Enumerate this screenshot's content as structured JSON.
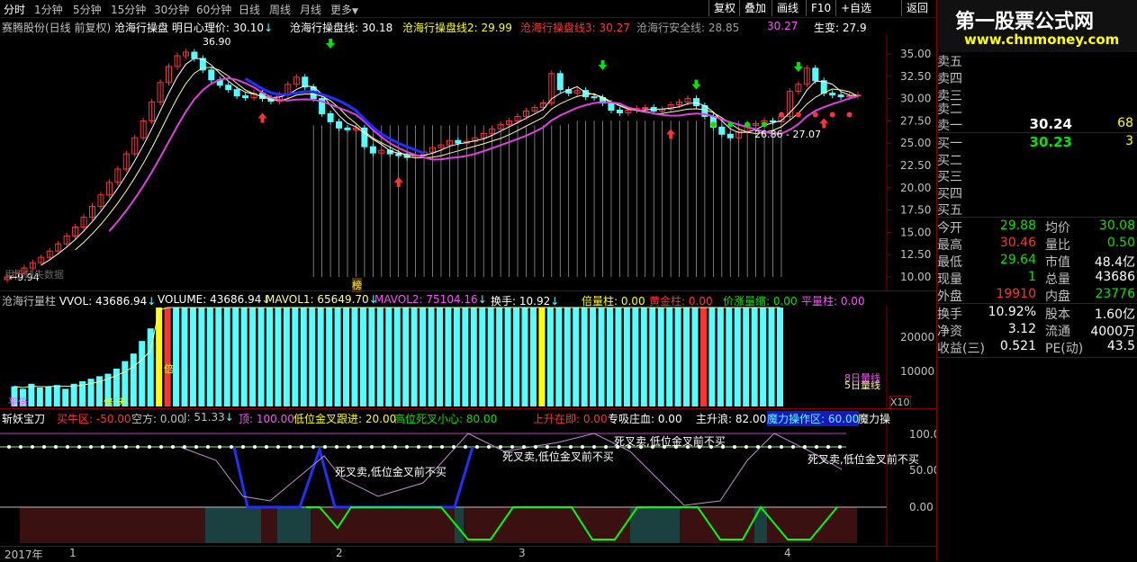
{
  "toolbar": {
    "tabs": [
      "分时",
      "1分钟",
      "5分钟",
      "15分钟",
      "30分钟",
      "60分钟",
      "日线",
      "周线",
      "月线",
      "更多"
    ],
    "active_tab": "分时",
    "more_arrow": "▼",
    "buttons": [
      "复权",
      "叠加",
      "画线",
      "F10",
      "+自选",
      "返回"
    ]
  },
  "main_legend": {
    "stock": "赛腾股份(日线 前复权)",
    "indicator": "沧海行操盘",
    "pivot": "明日心理价: 30.10",
    "line1": "沧海行操盘线: 30.18",
    "line2": "沧海行操盘线2: 29.99",
    "line3": "沧海行操盘线3: 30.27",
    "safe": "沧海行安全线: 28.85",
    "extra": "30.27",
    "change": "生变: 27.9"
  },
  "main_annotations": {
    "high_label": "36.90",
    "low_label": "9.94",
    "range_label": "26.86 - 27.07",
    "data_hint": "用于缺失数据",
    "buy_flag": "榜",
    "gap_tag": "缺"
  },
  "price_axis": [
    "35.00",
    "32.50",
    "30.00",
    "27.50",
    "25.00",
    "22.50",
    "20.00",
    "17.50",
    "15.00",
    "12.50",
    "10.00"
  ],
  "volume_legend": {
    "name": "沧海行量柱",
    "vvol": "VVOL: 43686.94",
    "volume": "VOLUME: 43686.94",
    "mavol1": "MAVOL1: 65649.70",
    "mavol2": "MAVOL2: 75104.16",
    "turnover": "换手: 10.92",
    "double": "倍量柱: 0.00",
    "gold": "黄金柱: 0.00",
    "shrink": "价涨量缩: 0.00",
    "flat": "平量柱: 0.00"
  },
  "volume_axis": [
    "20000",
    "10000"
  ],
  "volume_unit": "X10",
  "volume_tags": {
    "double": "倍",
    "flat": "平倍",
    "tian": "倍 天",
    "five": "5日量线",
    "eight": "8日量线"
  },
  "osc_legend": {
    "name": "斩妖宝刀",
    "buy_zone": "买牛区: -50.00",
    "short_zone": "空方: 0.00",
    "j": "J: 51.33",
    "top": "顶: 100.00",
    "low_gold": "低位金叉跟进: 20.00",
    "high_dead": "高位死叉小心: 80.00",
    "rise": "上升在即: 0.00",
    "absorb": "专吸庄血: 0.00",
    "wave": "主升浪: 82.00",
    "magic_zone": "魔力操作区: 60.00",
    "magic": "魔力操"
  },
  "osc_axis": [
    "100.0",
    "50.00",
    "0.00"
  ],
  "osc_notes": [
    "死叉卖,低位金叉前不买",
    "死叉卖,低位金叉前不买",
    "死叉卖,低位金叉前不买",
    "死叉卖,低位金叉前不买"
  ],
  "date_axis": [
    "2017年",
    "1",
    "2",
    "3",
    "4"
  ],
  "quote": {
    "sell_labels": [
      "卖五",
      "卖四",
      "卖三",
      "卖二",
      "卖一"
    ],
    "sell1_price": "30.24",
    "sell1_vol": "68",
    "buy_labels": [
      "买一",
      "买二",
      "买三",
      "买四",
      "买五"
    ],
    "buy1_price": "30.23",
    "buy1_vol": "3"
  },
  "stats": [
    {
      "l1": "今开",
      "v1": "29.88",
      "c1": "green",
      "l2": "均价",
      "v2": "30.08",
      "c2": "green"
    },
    {
      "l1": "最高",
      "v1": "30.46",
      "c1": "red",
      "l2": "量比",
      "v2": "0.50",
      "c2": "green"
    },
    {
      "l1": "最低",
      "v1": "29.64",
      "c1": "green",
      "l2": "市值",
      "v2": "48.4亿",
      "c2": "white"
    },
    {
      "l1": "现量",
      "v1": "1",
      "c1": "green",
      "l2": "总量",
      "v2": "43686",
      "c2": "white"
    },
    {
      "l1": "外盘",
      "v1": "19910",
      "c1": "red",
      "l2": "内盘",
      "v2": "23776",
      "c2": "green"
    }
  ],
  "fundamentals": [
    {
      "l1": "换手",
      "v1": "10.92%",
      "l2": "股本",
      "v2": "1.60亿"
    },
    {
      "l1": "净资",
      "v1": "3.12",
      "l2": "流通",
      "v2": "4000万"
    },
    {
      "l1": "收益(三)",
      "v1": "0.521",
      "l2": "PE(动)",
      "v2": "43.5"
    }
  ],
  "banner": {
    "title": "第一股票公式网",
    "url": "www.chnmoney.com"
  },
  "colors": {
    "up": "#ff3232",
    "down": "#54ffff",
    "grid": "#800000",
    "accent": "#ffff00"
  }
}
